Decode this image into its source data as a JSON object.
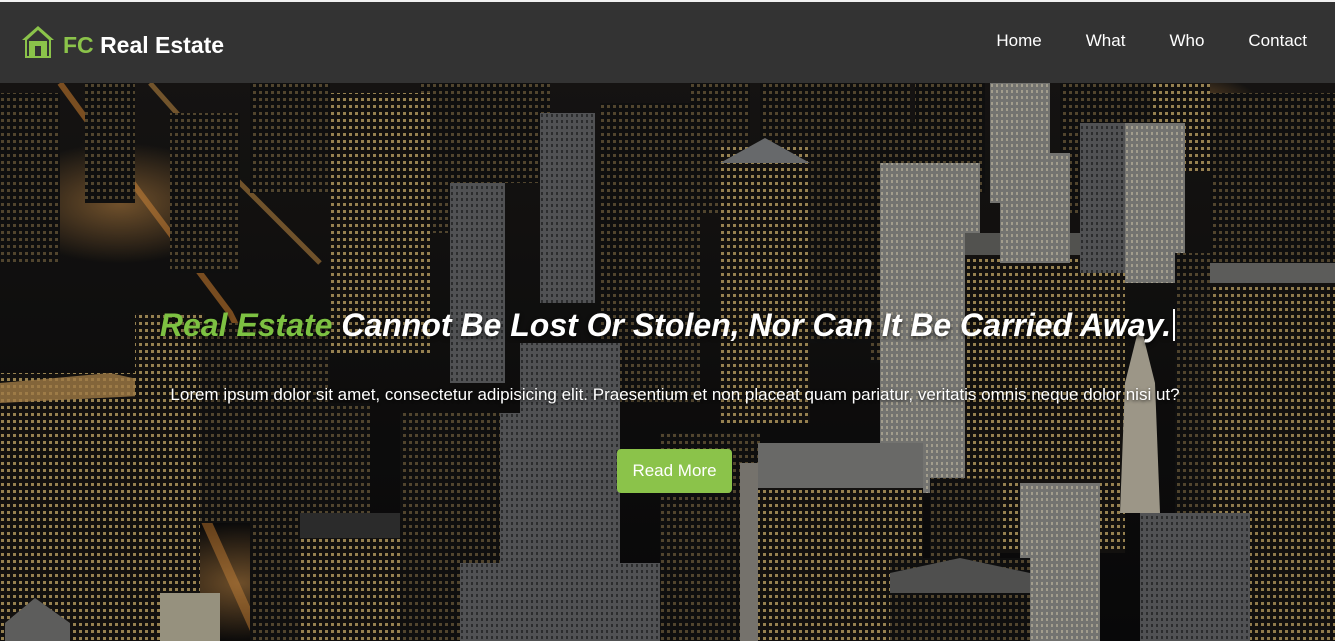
{
  "brand": {
    "accent_text": "FC",
    "name_text": "Real Estate",
    "icon": "house-icon",
    "accent_color": "#8bc34a"
  },
  "nav": {
    "items": [
      {
        "label": "Home"
      },
      {
        "label": "What"
      },
      {
        "label": "Who"
      },
      {
        "label": "Contact"
      }
    ]
  },
  "hero": {
    "headline_accent": "Real Estate",
    "headline_rest": " Cannot Be Lost Or Stolen, Nor Can It Be Carried Away.",
    "subtext": "Lorem ipsum dolor sit amet, consectetur adipisicing elit. Praesentium et non placeat quam pariatur, veritatis omnis neque dolor nisi ut?",
    "button_label": "Read More",
    "background_image": "city-skyline-at-night"
  }
}
